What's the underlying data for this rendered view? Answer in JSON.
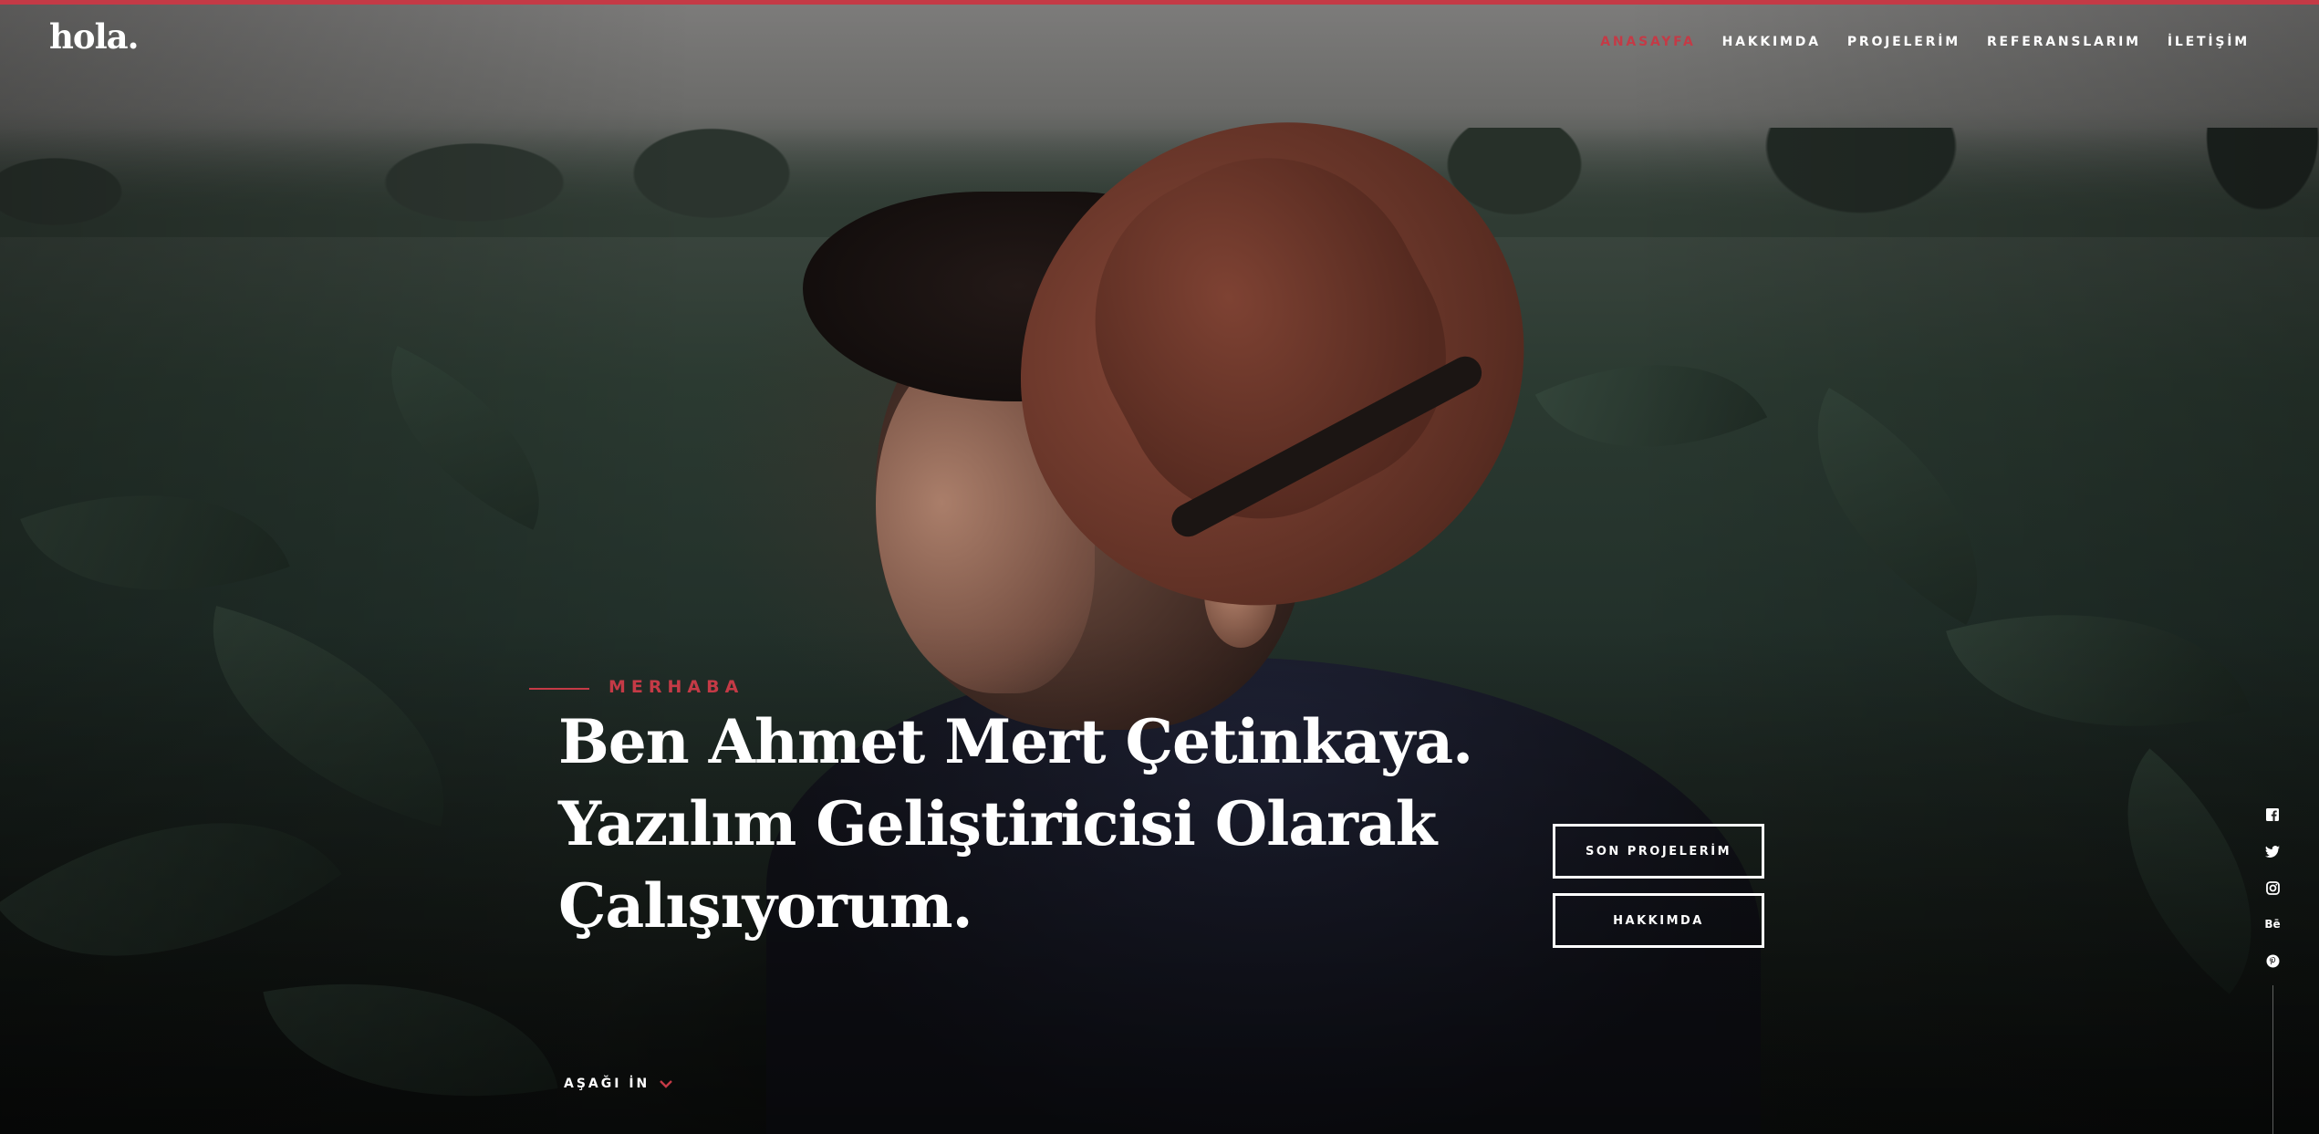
{
  "brand": {
    "logo": "hola."
  },
  "colors": {
    "accent": "#c43a46",
    "text": "#ffffff"
  },
  "nav": {
    "items": [
      {
        "label": "ANASAYFA",
        "active": true
      },
      {
        "label": "HAKKIMDA",
        "active": false
      },
      {
        "label": "PROJELERİM",
        "active": false
      },
      {
        "label": "REFERANSLARIM",
        "active": false
      },
      {
        "label": "İLETİŞİM",
        "active": false
      }
    ]
  },
  "intro": {
    "label": "MERHABA",
    "headline": [
      "Ben Ahmet Mert Çetinkaya.",
      "Yazılım Geliştiricisi Olarak",
      "Çalışıyorum."
    ]
  },
  "buttons": {
    "projects": "SON PROJELERİM",
    "about": "HAKKIMDA"
  },
  "scroll": {
    "label": "AŞAĞI İN",
    "icon": "chevron-down-icon"
  },
  "social": [
    {
      "name": "facebook-icon"
    },
    {
      "name": "twitter-icon"
    },
    {
      "name": "instagram-icon"
    },
    {
      "name": "behance-icon",
      "text": "Bē"
    },
    {
      "name": "pinterest-icon"
    }
  ]
}
